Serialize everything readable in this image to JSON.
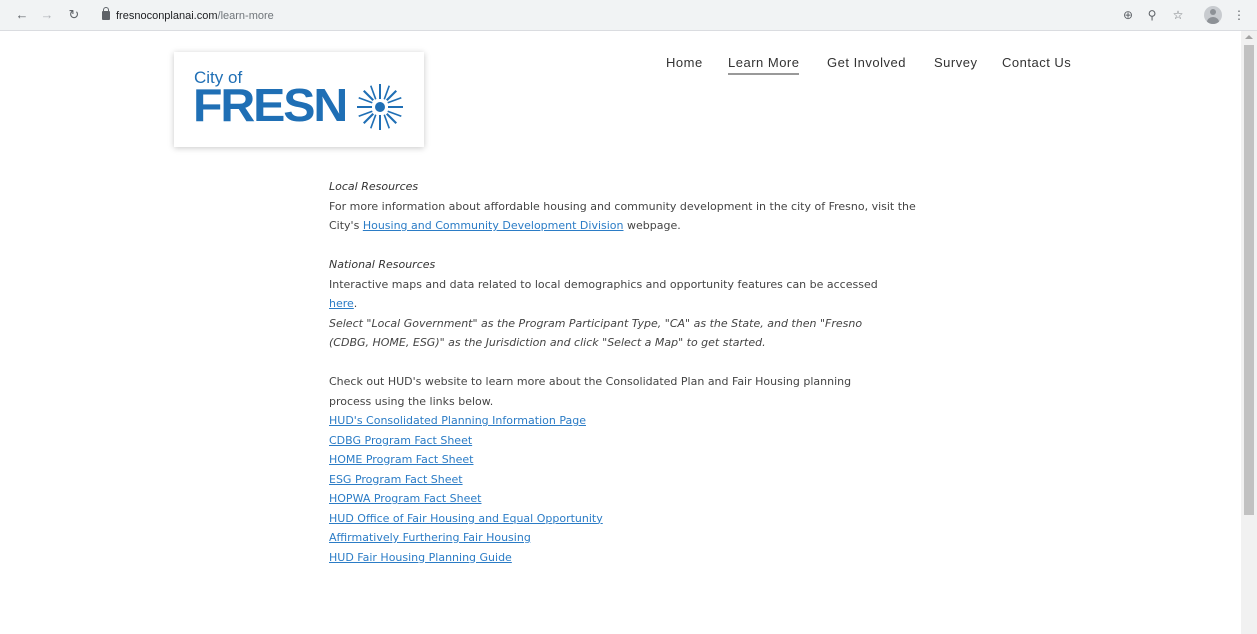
{
  "browser": {
    "url_domain": "fresnoconplanai.com",
    "url_path": "/learn-more"
  },
  "logo": {
    "city_of": "City of",
    "fresno": "FRESN"
  },
  "nav": {
    "items": [
      "Home",
      "Learn More",
      "Get Involved",
      "Survey",
      "Contact Us"
    ],
    "active": "Learn More"
  },
  "local": {
    "heading": "Local Resources",
    "text_before": "For more information about affordable housing and community development in the city of Fresno, visit the City's ",
    "link": "Housing and Community Development Division",
    "text_after": " webpage."
  },
  "national": {
    "heading": "National Resources",
    "text_before": "Interactive maps and data related to local demographics and opportunity features can be accessed ",
    "link": "here",
    "text_after": ".",
    "instructions": "Select \"Local Government\" as the Program Participant Type, \"CA\" as the State, and then \"Fresno (CDBG, HOME, ESG)\" as the Jurisdiction and click \"Select a Map\" to get started."
  },
  "hud": {
    "intro": "Check out HUD's website to learn more about the Consolidated Plan and Fair Housing planning process using the links below.",
    "links": [
      "HUD's Consolidated Planning Information Page",
      "CDBG Program Fact Sheet",
      "HOME Program Fact Sheet",
      "ESG Program Fact Sheet",
      "HOPWA Program Fact Sheet",
      "HUD Office of Fair Housing and Equal Opportunity",
      "Affirmatively Furthering Fair Housing",
      "HUD Fair Housing Planning Guide"
    ]
  },
  "colors": {
    "brand_blue": "#1f6fb5",
    "link_blue": "#2b7cc6"
  }
}
